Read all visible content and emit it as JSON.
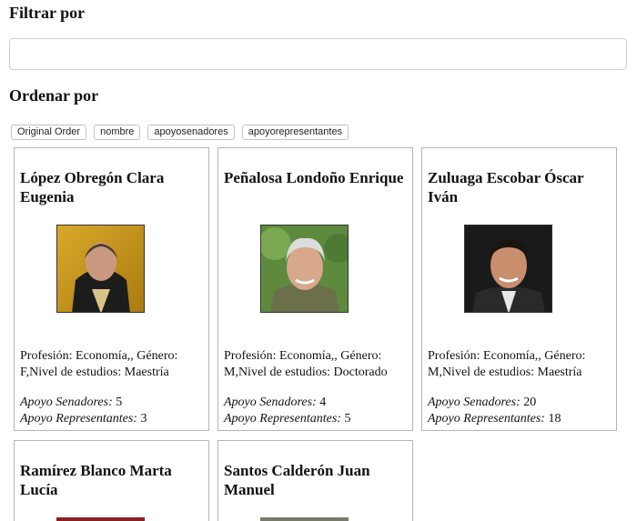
{
  "filter": {
    "heading": "Filtrar por",
    "value": "",
    "placeholder": ""
  },
  "sort": {
    "heading": "Ordenar por",
    "buttons": [
      "Original Order",
      "nombre",
      "apoyosenadores",
      "apoyorepresentantes"
    ]
  },
  "labels": {
    "apoyo_senadores": "Apoyo Senadores:",
    "apoyo_representantes": "Apoyo Representantes:"
  },
  "cards": [
    {
      "name": "López Obregón Clara Eugenia",
      "info": "Profesión: Economía,, Género: F,Nivel de estudios: Maestría",
      "apoyo_senadores": "5",
      "apoyo_representantes": "3"
    },
    {
      "name": "Peñalosa Londoño Enrique",
      "info": "Profesión: Economía,, Género: M,Nivel de estudios: Doctorado",
      "apoyo_senadores": "4",
      "apoyo_representantes": "5"
    },
    {
      "name": "Zuluaga Escobar Óscar Iván",
      "info": "Profesión: Economía,, Género: M,Nivel de estudios: Maestría",
      "apoyo_senadores": "20",
      "apoyo_representantes": "18"
    },
    {
      "name": "Ramírez Blanco Marta Lucía"
    },
    {
      "name": "Santos Calderón Juan Manuel"
    }
  ]
}
